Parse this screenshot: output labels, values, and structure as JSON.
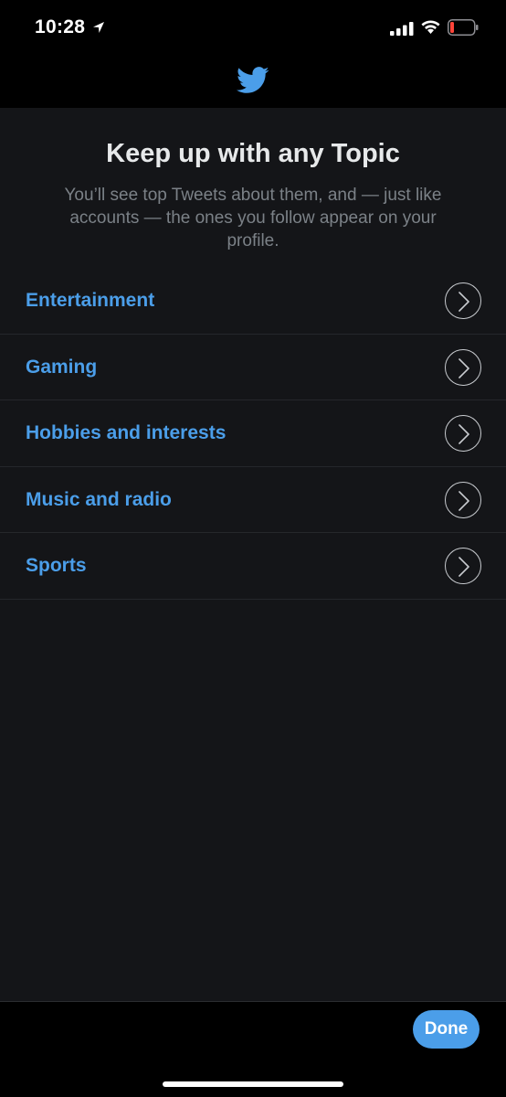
{
  "status_bar": {
    "time": "10:28",
    "battery_color": "#ff453a"
  },
  "header": {
    "logo_icon": "twitter-bird-icon",
    "accent_color": "#4b9ee9"
  },
  "main": {
    "title": "Keep up with any Topic",
    "subtitle": "You’ll see top Tweets about them, and — just like accounts — the ones you follow appear on your profile.",
    "topics": [
      {
        "label": "Entertainment"
      },
      {
        "label": "Gaming"
      },
      {
        "label": "Hobbies and interests"
      },
      {
        "label": "Music and radio"
      },
      {
        "label": "Sports"
      }
    ]
  },
  "footer": {
    "done_label": "Done"
  }
}
